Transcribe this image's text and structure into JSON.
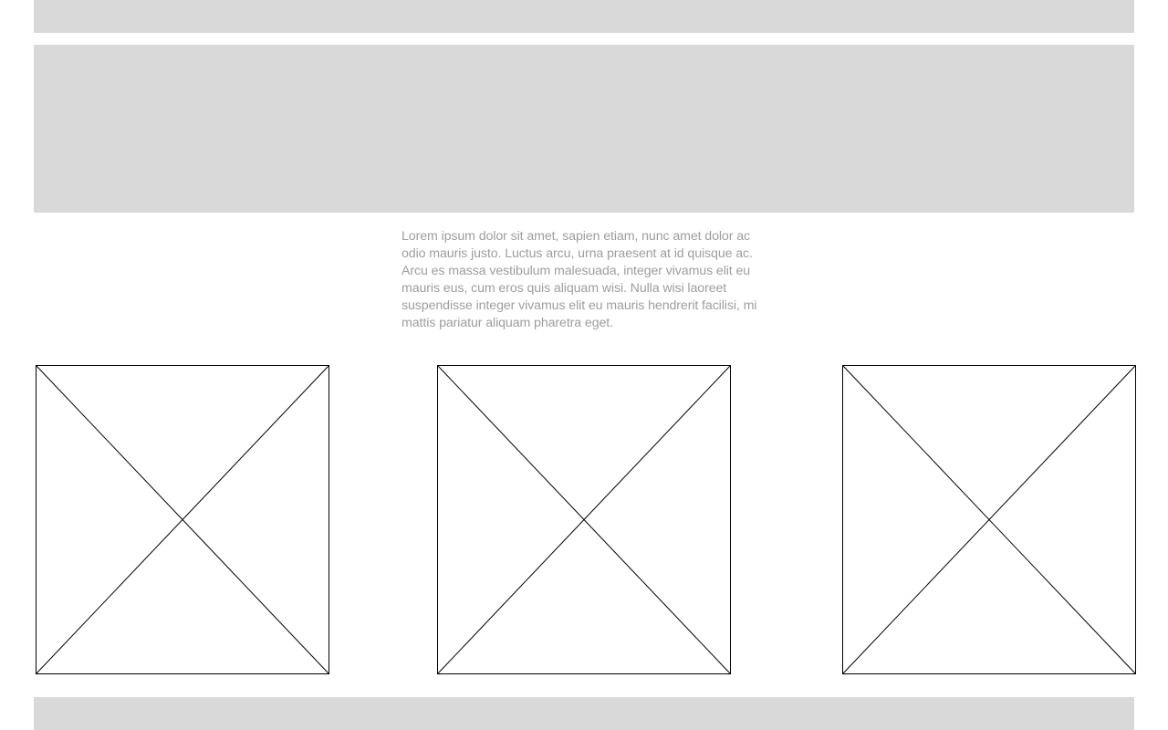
{
  "colors": {
    "block_fill": "#d9d9d9",
    "text": "#9e9e9e",
    "placeholder_stroke": "#000000",
    "background": "#ffffff"
  },
  "intro": {
    "text": "Lorem ipsum dolor sit amet, sapien etiam, nunc amet dolor ac odio mauris justo. Luctus arcu, urna praesent at id quisque ac. Arcu es massa vestibulum malesuada, integer vivamus elit eu mauris eus, cum eros quis aliquam wisi. Nulla wisi laoreet suspendisse integer vivamus elit eu mauris hendrerit facilisi, mi mattis pariatur aliquam pharetra eget."
  },
  "image_placeholders": [
    {
      "icon": "image-placeholder-icon"
    },
    {
      "icon": "image-placeholder-icon"
    },
    {
      "icon": "image-placeholder-icon"
    }
  ]
}
